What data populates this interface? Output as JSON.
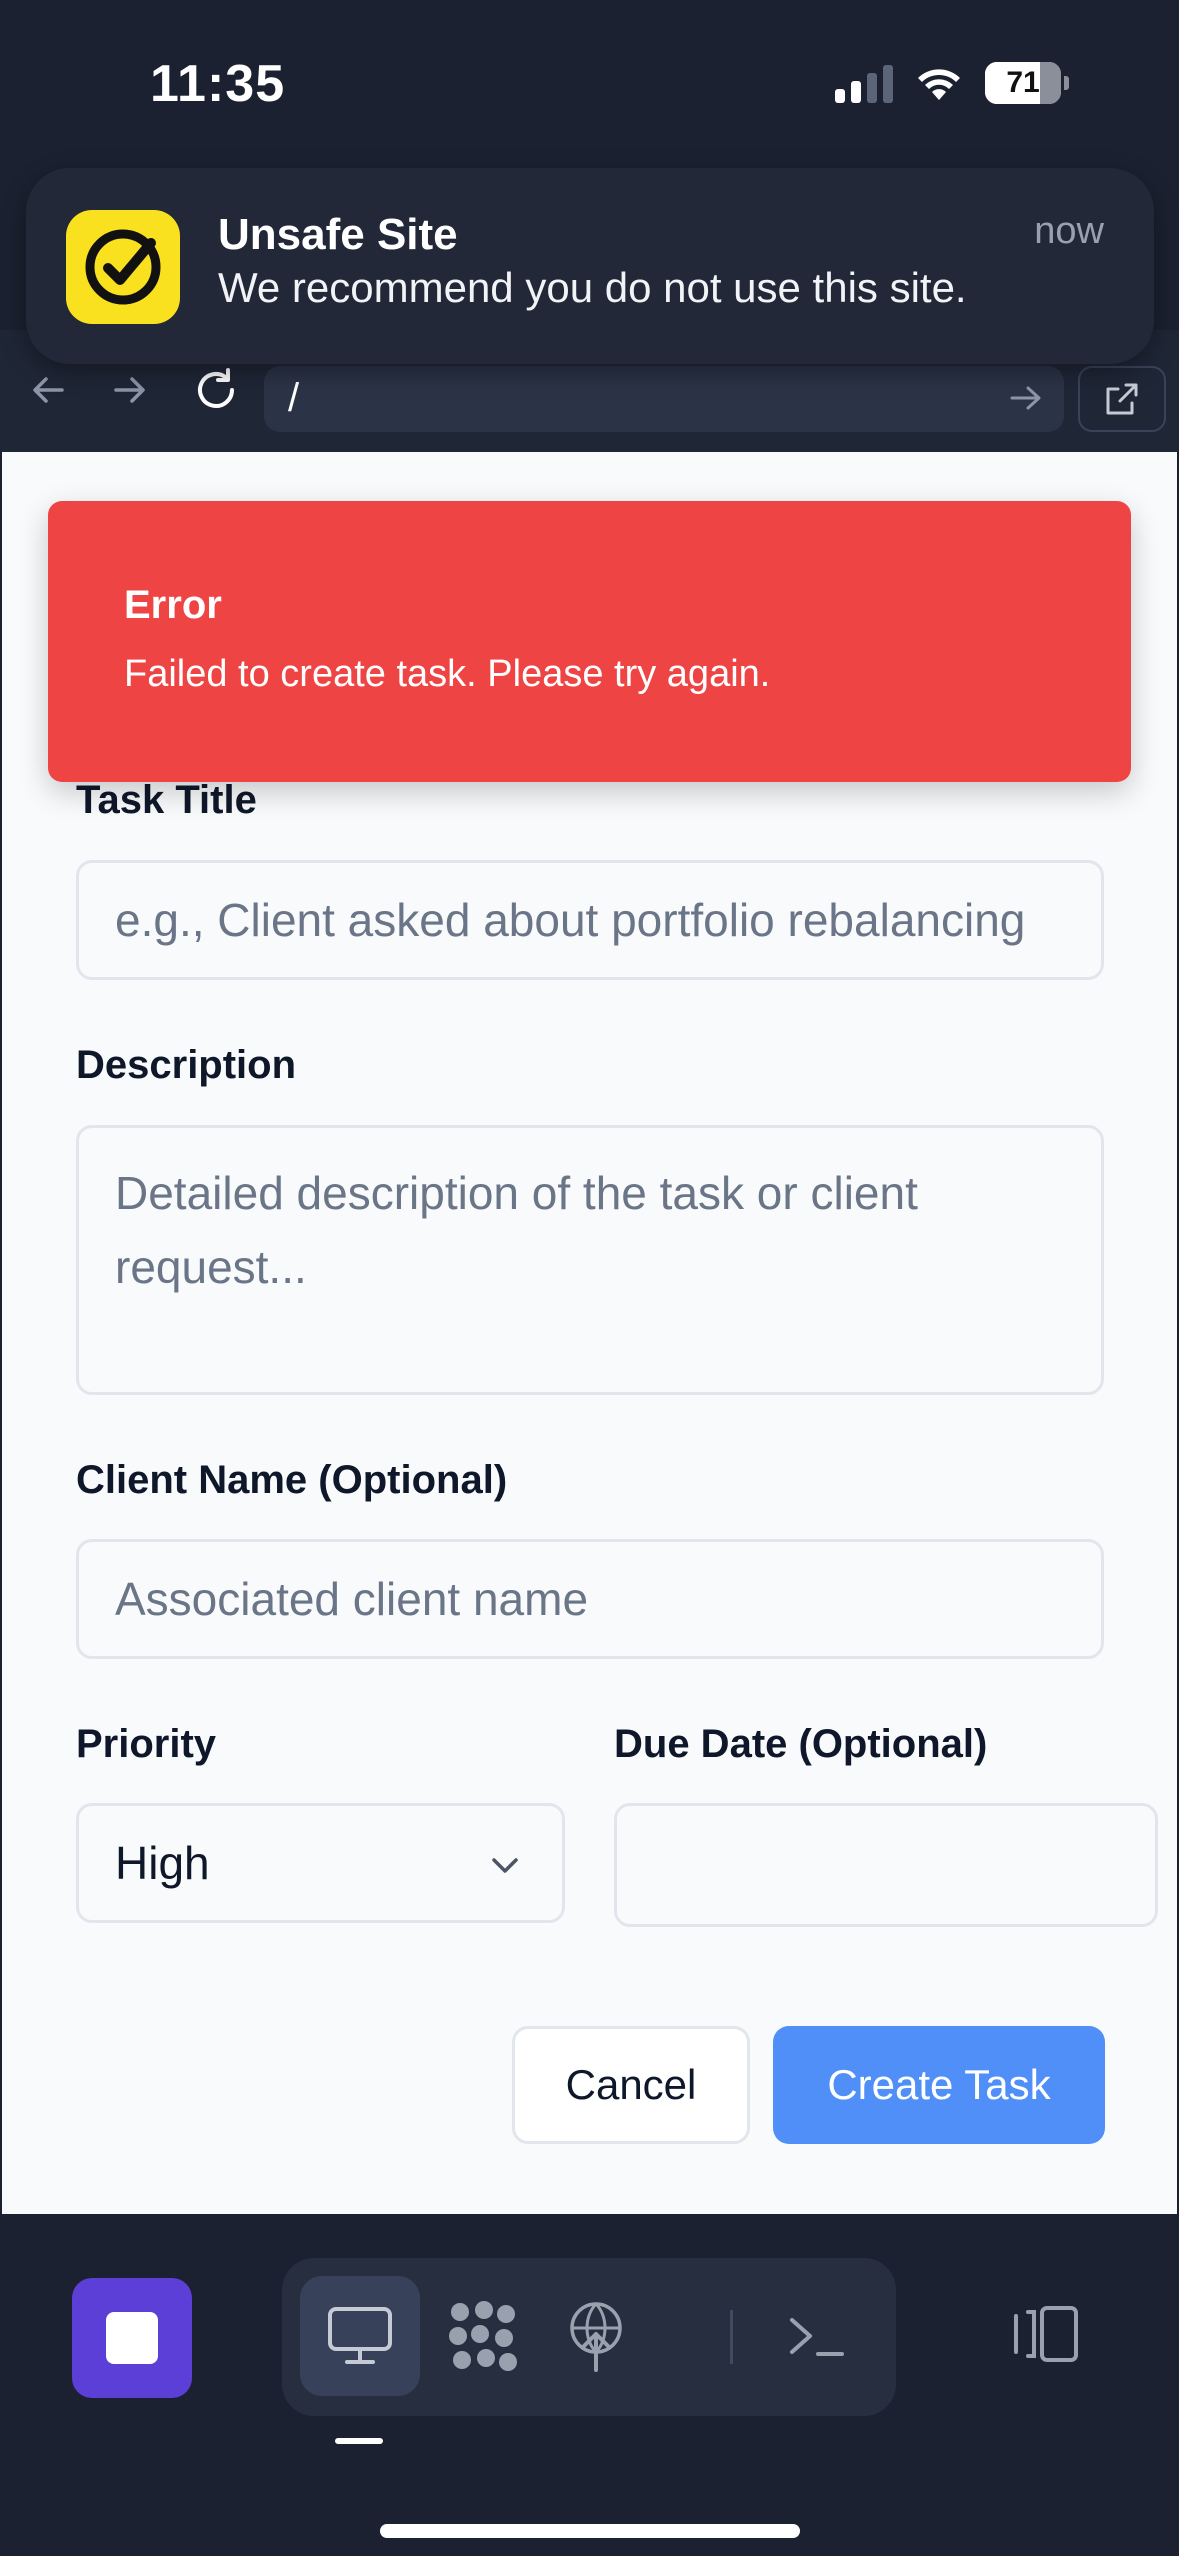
{
  "status_bar": {
    "time": "11:35",
    "battery": "71"
  },
  "notification": {
    "title": "Unsafe Site",
    "body": "We recommend you do not use this site.",
    "time": "now",
    "icon": "check-badge-icon"
  },
  "browser": {
    "url": "/"
  },
  "toast": {
    "title": "Error",
    "message": "Failed to create task. Please try again.",
    "color": "#ef4444"
  },
  "form": {
    "task_title": {
      "label": "Task Title",
      "placeholder": "e.g., Client asked about portfolio rebalancing"
    },
    "description": {
      "label": "Description",
      "placeholder": "Detailed description of the task or client request..."
    },
    "client_name": {
      "label": "Client Name (Optional)",
      "placeholder": "Associated client name"
    },
    "priority": {
      "label": "Priority",
      "value": "High"
    },
    "due_date": {
      "label": "Due Date (Optional)",
      "value": ""
    },
    "cancel_label": "Cancel",
    "create_label": "Create Task",
    "accent": "#4f8ff7"
  },
  "bottom_bar": {
    "tabs": [
      "monitor-icon",
      "grid-dots-icon",
      "antenna-icon",
      "terminal-icon"
    ],
    "active_tab": 0
  }
}
